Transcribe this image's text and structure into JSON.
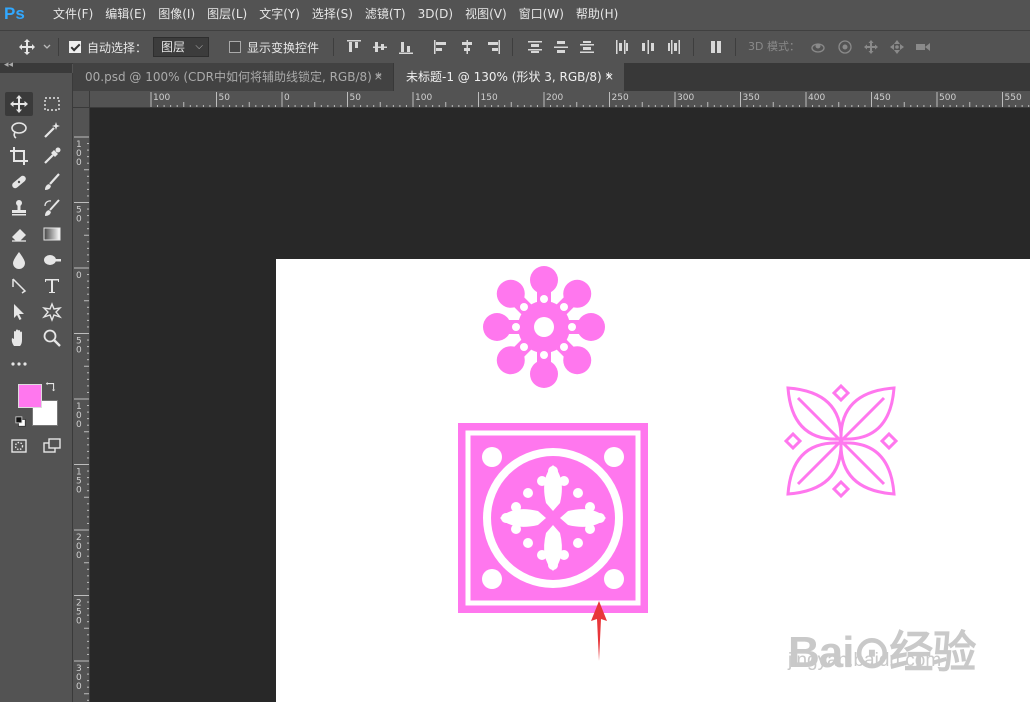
{
  "app": {
    "logo": "Ps"
  },
  "menu": [
    "文件(F)",
    "编辑(E)",
    "图像(I)",
    "图层(L)",
    "文字(Y)",
    "选择(S)",
    "滤镜(T)",
    "3D(D)",
    "视图(V)",
    "窗口(W)",
    "帮助(H)"
  ],
  "options": {
    "auto_select_label": "自动选择：",
    "auto_select_checked": true,
    "auto_select_target": "图层",
    "show_transform_label": "显示变换控件",
    "show_transform_checked": false,
    "mode_3d_label": "3D 模式："
  },
  "toolbar_collapse": "◂◂",
  "tabs": [
    {
      "label": "00.psd @ 100% (CDR中如何将辅助线锁定, RGB/8) *",
      "close": "×",
      "active": false
    },
    {
      "label": "未标题-1 @ 130% (形状 3, RGB/8) *",
      "close": "×",
      "active": true
    }
  ],
  "ruler": {
    "h_labels": [
      "100",
      "50",
      "0",
      "50",
      "100",
      "150",
      "200",
      "250",
      "300",
      "350",
      "400",
      "450",
      "500",
      "550"
    ],
    "v_labels": [
      "100",
      "50",
      "0",
      "50",
      "100",
      "150",
      "200",
      "250",
      "300"
    ]
  },
  "colors": {
    "foreground": "#ff77ee",
    "background": "#ffffff",
    "shape_pink": "#ff77ee",
    "annotation_arrow": "#e8363a"
  },
  "watermark": {
    "text": "Bai⊙经验",
    "sub": "jingyan.baidu.com"
  }
}
